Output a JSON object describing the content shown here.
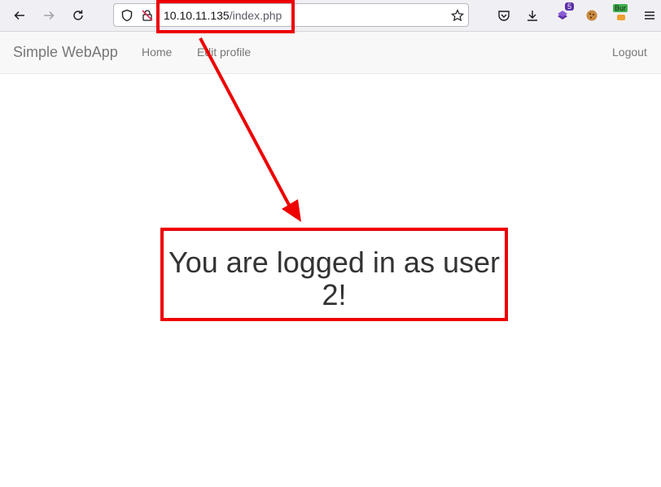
{
  "browser": {
    "url_host": "10.10.11.135",
    "url_path": "/index.php",
    "extension_badge_count": "5",
    "extension_badge_label": "Bur",
    "icons": [
      "back-arrow-icon",
      "forward-arrow-icon",
      "reload-icon",
      "shield-icon",
      "insecure-lock-icon",
      "bookmark-star-icon",
      "pocket-icon",
      "download-icon",
      "extension-icon",
      "cookie-icon",
      "burp-icon",
      "menu-icon"
    ]
  },
  "navbar": {
    "brand": "Simple WebApp",
    "links": [
      {
        "label": "Home"
      },
      {
        "label": "Edit profile"
      }
    ],
    "logout": "Logout"
  },
  "main": {
    "message": "You are logged in as user 2!"
  },
  "colors": {
    "annotation": "#ee0000",
    "navbar_bg": "#f8f8f8",
    "text": "#333333",
    "nav_text": "#777777"
  }
}
